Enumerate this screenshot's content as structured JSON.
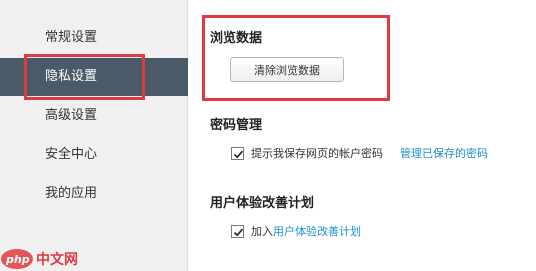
{
  "sidebar": {
    "items": [
      {
        "label": "常规设置"
      },
      {
        "label": "隐私设置"
      },
      {
        "label": "高级设置"
      },
      {
        "label": "安全中心"
      },
      {
        "label": "我的应用"
      }
    ]
  },
  "sections": {
    "browsing_data": {
      "title": "浏览数据",
      "clear_button": "清除浏览数据"
    },
    "password": {
      "title": "密码管理",
      "checkbox_label": "提示我保存网页的帐户密码",
      "checked": true,
      "manage_link": "管理已保存的密码"
    },
    "ux_plan": {
      "title": "用户体验改善计划",
      "join_prefix": "加入",
      "join_link": "用户体验改善计划",
      "checked": true
    }
  },
  "watermark": {
    "text": "中文网",
    "logo_text": "php"
  },
  "colors": {
    "active_item_bg": "#4a5a68",
    "link": "#1e90c8",
    "highlight_box": "#e0393e"
  }
}
